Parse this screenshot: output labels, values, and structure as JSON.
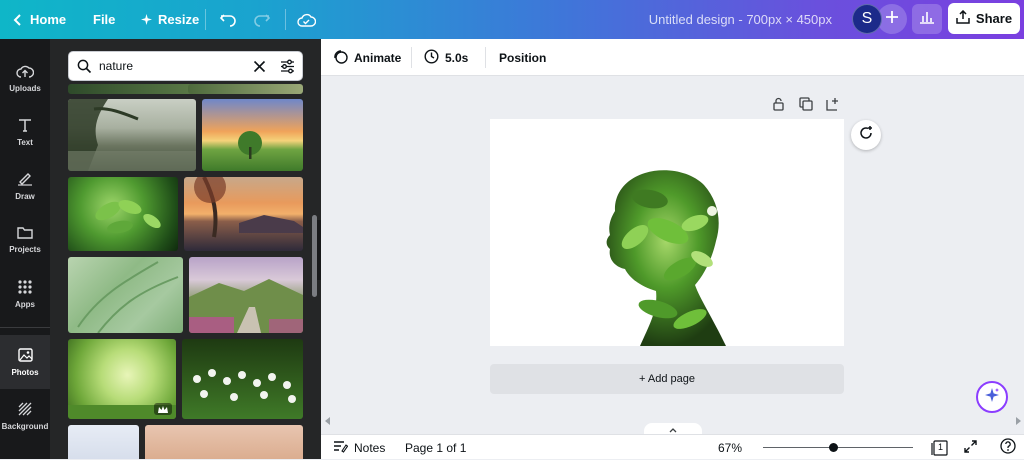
{
  "topbar": {
    "home_label": "Home",
    "file_label": "File",
    "resize_label": "Resize",
    "design_title": "Untitled design - 700px × 450px",
    "avatar_initial": "S",
    "share_label": "Share",
    "gradient_colors": [
      "#0fb6c8",
      "#3f76d9",
      "#7a3fe0"
    ]
  },
  "rail": {
    "items": [
      {
        "label": "Uploads",
        "icon": "cloud-upload-icon"
      },
      {
        "label": "Text",
        "icon": "text-icon"
      },
      {
        "label": "Draw",
        "icon": "pen-icon"
      },
      {
        "label": "Projects",
        "icon": "folder-icon"
      },
      {
        "label": "Apps",
        "icon": "apps-grid-icon"
      },
      {
        "label": "Photos",
        "icon": "photo-icon",
        "active": true
      },
      {
        "label": "Background",
        "icon": "background-icon"
      }
    ]
  },
  "search": {
    "value": "nature"
  },
  "photos": [
    {
      "name": "misty-forest-lake"
    },
    {
      "name": "sunset-tree-field"
    },
    {
      "name": "green-leaves"
    },
    {
      "name": "lake-tree-sunset"
    },
    {
      "name": "fern-fronds"
    },
    {
      "name": "mountain-path-flowers",
      "icon": "crown-icon"
    },
    {
      "name": "sunlit-meadow"
    },
    {
      "name": "white-daisies"
    }
  ],
  "context_toolbar": {
    "animate_label": "Animate",
    "duration_label": "5.0s",
    "position_label": "Position"
  },
  "canvas": {
    "add_page_label": "+ Add page"
  },
  "bottom": {
    "notes_label": "Notes",
    "page_label": "Page 1 of 1",
    "zoom_label": "67%",
    "zoom_level": 0.67,
    "page_count_badge": "1"
  }
}
